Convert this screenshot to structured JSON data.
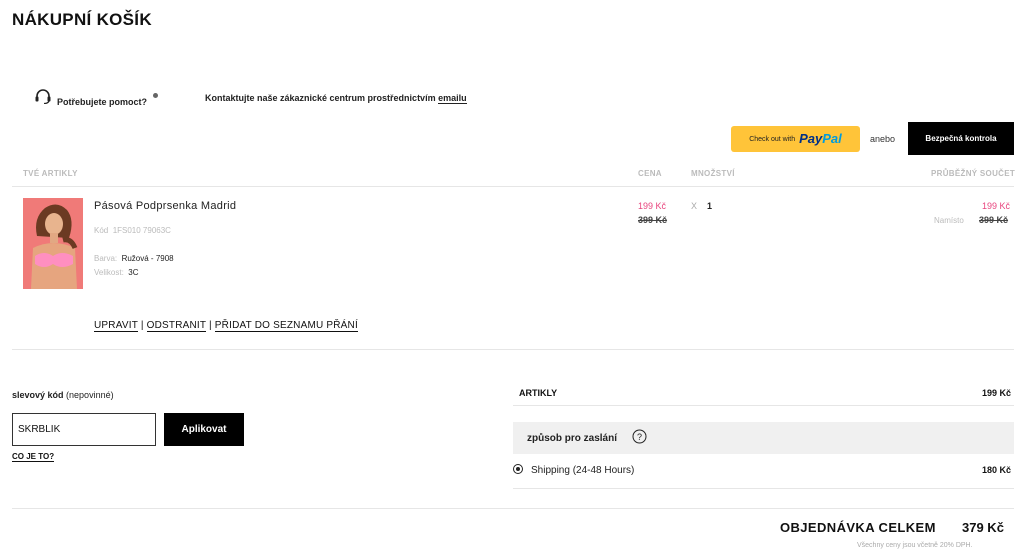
{
  "page": {
    "title": "NÁKUPNÍ KOŠÍK"
  },
  "help": {
    "question": "Potřebujete pomoct?",
    "contact_text": "Kontaktujte naše zákaznické centrum prostřednictvím ",
    "contact_link": "emailu"
  },
  "checkout": {
    "paypal_prefix": "Check out with",
    "paypal_brand_1": "Pay",
    "paypal_brand_2": "Pal",
    "or_text": "anebo",
    "secure_checkout": "Bezpečná kontrola"
  },
  "table": {
    "headers": {
      "items": "TVÉ ARTIKLY",
      "price": "CENA",
      "quantity": "MNOŽSTVÍ",
      "subtotal": "PRŮBĚŽNÝ SOUČET"
    }
  },
  "item": {
    "name": "Pásová Podprsenka Madrid",
    "code_label": "Kód",
    "code": "1FS010 79063C",
    "color_label": "Barva:",
    "color": "Ružová - 7908",
    "size_label": "Velikost:",
    "size": "3C",
    "price": "199 Kč",
    "price_original": "399 Kč",
    "qty_prefix": "X",
    "quantity": "1",
    "subtotal": "199 Kč",
    "subtotal_prefix": "Namísto",
    "subtotal_original": "399 Kč",
    "actions": {
      "edit": "UPRAVIT",
      "remove": "ODSTRANIT",
      "wishlist": "PŘIDAT DO SEZNAMU PŘÁNÍ",
      "separator": "|"
    }
  },
  "coupon": {
    "label": "slevový kód",
    "label_optional": "(nepovinné)",
    "value": "SKRBLIK",
    "apply": "Aplikovat",
    "whats_this": "CO JE TO?"
  },
  "summary": {
    "items_label": "ARTIKLY",
    "items_value": "199 Kč",
    "shipping_title": "způsob pro zaslání",
    "shipping_option": "Shipping (24-48 Hours)",
    "shipping_value": "180 Kč",
    "total_label": "OBJEDNÁVKA CELKEM",
    "total_value": "379 Kč",
    "vat_note": "Všechny ceny jsou včetně 20% DPH."
  },
  "colors": {
    "accent_pink": "#e8457e",
    "paypal_yellow": "#ffc439",
    "paypal_blue": "#003087",
    "paypal_light_blue": "#009cde"
  },
  "icons": {
    "help": "headset-icon",
    "shipping_info": "question-circle-icon"
  }
}
